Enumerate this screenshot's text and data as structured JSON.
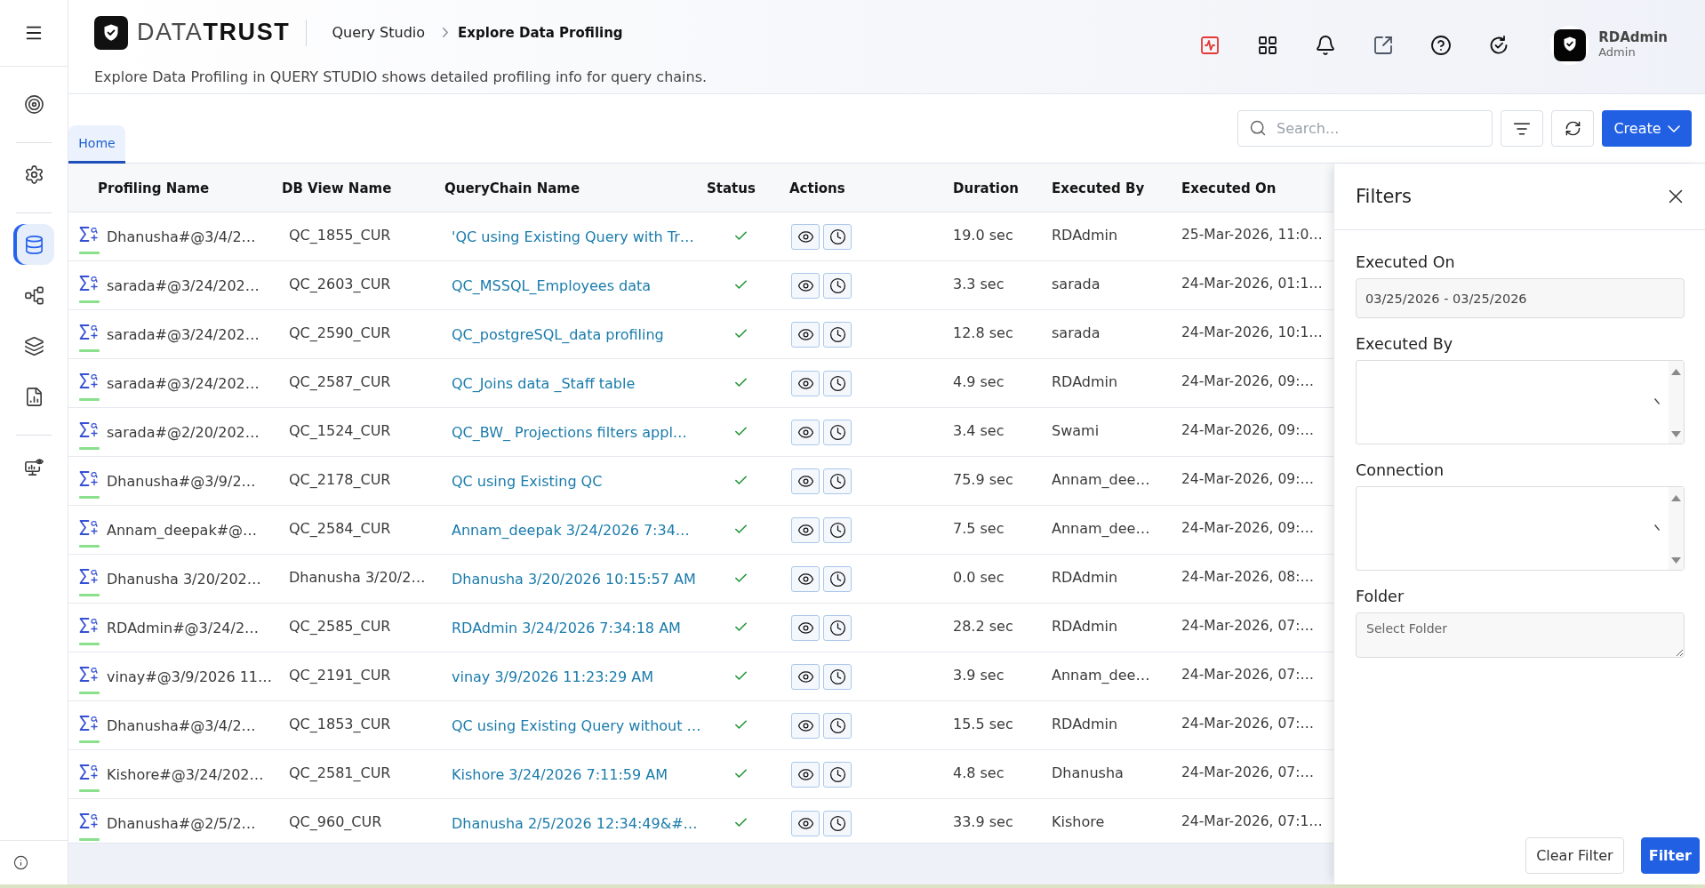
{
  "sidebar": {
    "groups": [
      {
        "items": [
          {
            "selected": false
          }
        ]
      },
      {
        "items": [
          {
            "selected": false
          }
        ]
      },
      {
        "items": [
          {
            "selected": true
          },
          {
            "selected": false
          },
          {
            "selected": false
          },
          {
            "selected": false
          }
        ]
      },
      {
        "items": [
          {
            "selected": false
          }
        ]
      }
    ]
  },
  "header": {
    "logo": "DATA**TRUST**",
    "breadcrumbs": [
      {
        "label": "Query Studio",
        "current": false
      },
      {
        "label": "Explore Data Profiling",
        "current": true
      }
    ],
    "description": "Explore Data Profiling in QUERY STUDIO shows detailed profiling info for query chains.",
    "user": {
      "name": "RDAdmin",
      "role": "Admin"
    }
  },
  "tabs": [
    {
      "label": "Home",
      "selected": true
    }
  ],
  "toolbar": {
    "search": {
      "placeholder": "Search..."
    },
    "create_button": "Create"
  },
  "table": {
    "columns": [
      "Profiling Name",
      "DB View Name",
      "QueryChain Name",
      "Status",
      "Actions",
      "Duration",
      "Executed By",
      "Executed On"
    ],
    "rows": [
      {
        "profiling_name": "Dhanusha#@3/4/2…",
        "db_view_name": "QC_1855_CUR",
        "querychain_name": "'QC using Existing Query with Tr…",
        "success": true,
        "duration": "19.0 sec",
        "executed_by": "RDAdmin",
        "executed_on": "25-Mar-2026, 11:0…"
      },
      {
        "profiling_name": "sarada#@3/24/202…",
        "db_view_name": "QC_2603_CUR",
        "querychain_name": "QC_MSSQL_Employees data",
        "success": true,
        "duration": "3.3 sec",
        "executed_by": "sarada",
        "executed_on": "24-Mar-2026, 01:1…"
      },
      {
        "profiling_name": "sarada#@3/24/202…",
        "db_view_name": "QC_2590_CUR",
        "querychain_name": "QC_postgreSQL_data profiling",
        "success": true,
        "duration": "12.8 sec",
        "executed_by": "sarada",
        "executed_on": "24-Mar-2026, 10:1…"
      },
      {
        "profiling_name": "sarada#@3/24/202…",
        "db_view_name": "QC_2587_CUR",
        "querychain_name": "QC_Joins data _Staff table",
        "success": true,
        "duration": "4.9 sec",
        "executed_by": "RDAdmin",
        "executed_on": "24-Mar-2026, 09:…"
      },
      {
        "profiling_name": "sarada#@2/20/202…",
        "db_view_name": "QC_1524_CUR",
        "querychain_name": "QC_BW_ Projections filters appl…",
        "success": true,
        "duration": "3.4 sec",
        "executed_by": "Swami",
        "executed_on": "24-Mar-2026, 09:…"
      },
      {
        "profiling_name": "Dhanusha#@3/9/2…",
        "db_view_name": "QC_2178_CUR",
        "querychain_name": "QC using Existing QC",
        "success": true,
        "duration": "75.9 sec",
        "executed_by": "Annam_dee…",
        "executed_on": "24-Mar-2026, 09:…"
      },
      {
        "profiling_name": "Annam_deepak#@…",
        "db_view_name": "QC_2584_CUR",
        "querychain_name": "Annam_deepak 3/24/2026 7:34…",
        "success": true,
        "duration": "7.5 sec",
        "executed_by": "Annam_dee…",
        "executed_on": "24-Mar-2026, 09:…"
      },
      {
        "profiling_name": "Dhanusha 3/20/202…",
        "db_view_name": "Dhanusha 3/20/2…",
        "querychain_name": "Dhanusha 3/20/2026 10:15:57 AM",
        "success": true,
        "duration": "0.0 sec",
        "executed_by": "RDAdmin",
        "executed_on": "24-Mar-2026, 08:…"
      },
      {
        "profiling_name": "RDAdmin#@3/24/2…",
        "db_view_name": "QC_2585_CUR",
        "querychain_name": "RDAdmin 3/24/2026 7:34:18 AM",
        "success": true,
        "duration": "28.2 sec",
        "executed_by": "RDAdmin",
        "executed_on": "24-Mar-2026, 07:…"
      },
      {
        "profiling_name": "vinay#@3/9/2026 11…",
        "db_view_name": "QC_2191_CUR",
        "querychain_name": "vinay 3/9/2026 11:23:29 AM",
        "success": true,
        "duration": "3.9 sec",
        "executed_by": "Annam_dee…",
        "executed_on": "24-Mar-2026, 07:…"
      },
      {
        "profiling_name": "Dhanusha#@3/4/2…",
        "db_view_name": "QC_1853_CUR",
        "querychain_name": "QC using Existing Query without …",
        "success": true,
        "duration": "15.5 sec",
        "executed_by": "RDAdmin",
        "executed_on": "24-Mar-2026, 07:…"
      },
      {
        "profiling_name": "Kishore#@3/24/202…",
        "db_view_name": "QC_2581_CUR",
        "querychain_name": "Kishore 3/24/2026 7:11:59 AM",
        "success": true,
        "duration": "4.8 sec",
        "executed_by": "Dhanusha",
        "executed_on": "24-Mar-2026, 07:…"
      },
      {
        "profiling_name": "Dhanusha#@2/5/2…",
        "db_view_name": "QC_960_CUR",
        "querychain_name": "Dhanusha 2/5/2026 12:34:49&#…",
        "success": true,
        "duration": "33.9 sec",
        "executed_by": "Kishore",
        "executed_on": "24-Mar-2026, 07:1…"
      }
    ]
  },
  "filters": {
    "title": "Filters",
    "fields": [
      {
        "label": "Executed On",
        "kind": "date",
        "value": "03/25/2026 - 03/25/2026"
      },
      {
        "label": "Executed By",
        "kind": "listbox"
      },
      {
        "label": "Connection",
        "kind": "listbox"
      },
      {
        "label": "Folder",
        "kind": "textarea",
        "placeholder": "Select Folder"
      }
    ],
    "buttons": [
      {
        "label": "Clear Filter",
        "kind": "secondary"
      },
      {
        "label": "Filter",
        "kind": "primary"
      }
    ]
  }
}
